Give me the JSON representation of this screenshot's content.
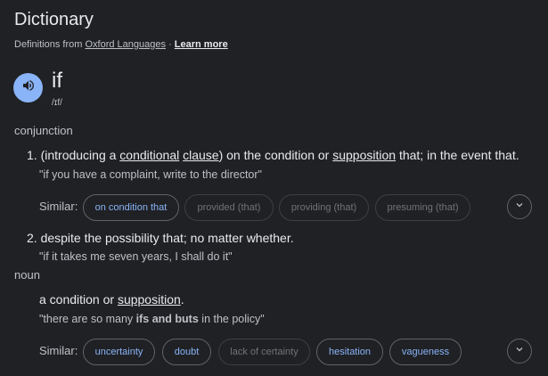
{
  "header": {
    "title": "Dictionary",
    "defs_prefix": "Definitions from",
    "source_link": "Oxford Languages",
    "separator": "·",
    "learn_more": "Learn more"
  },
  "entry": {
    "word": "if",
    "phonetic": "/ɪf/",
    "audio_icon": "speaker-icon"
  },
  "conjunction": {
    "label": "conjunction",
    "senses": [
      {
        "number": "1.",
        "parts": [
          "(introducing a ",
          "conditional",
          " ",
          "clause",
          ") on the condition or ",
          "supposition",
          " that; in the event that."
        ],
        "example": "\"if you have a complaint, write to the director\"",
        "similar_label": "Similar:",
        "similar": [
          {
            "text": "on condition that",
            "active": true
          },
          {
            "text": "provided (that)",
            "active": false
          },
          {
            "text": "providing (that)",
            "active": false
          },
          {
            "text": "presuming (that)",
            "active": false
          }
        ]
      },
      {
        "number": "2.",
        "text": "despite the possibility that; no matter whether.",
        "example": "\"if it takes me seven years, I shall do it\""
      }
    ]
  },
  "noun": {
    "label": "noun",
    "def_pre": "a condition or ",
    "def_link": "supposition",
    "def_post": ".",
    "example_pre": "\"there are so many ",
    "example_bold": "ifs and buts",
    "example_post": " in the policy\"",
    "similar_label": "Similar:",
    "similar": [
      {
        "text": "uncertainty",
        "active": true
      },
      {
        "text": "doubt",
        "active": true
      },
      {
        "text": "lack of certainty",
        "active": false
      },
      {
        "text": "hesitation",
        "active": true
      },
      {
        "text": "vagueness",
        "active": true
      }
    ]
  },
  "icons": {
    "expand": "chevron-down-icon"
  }
}
